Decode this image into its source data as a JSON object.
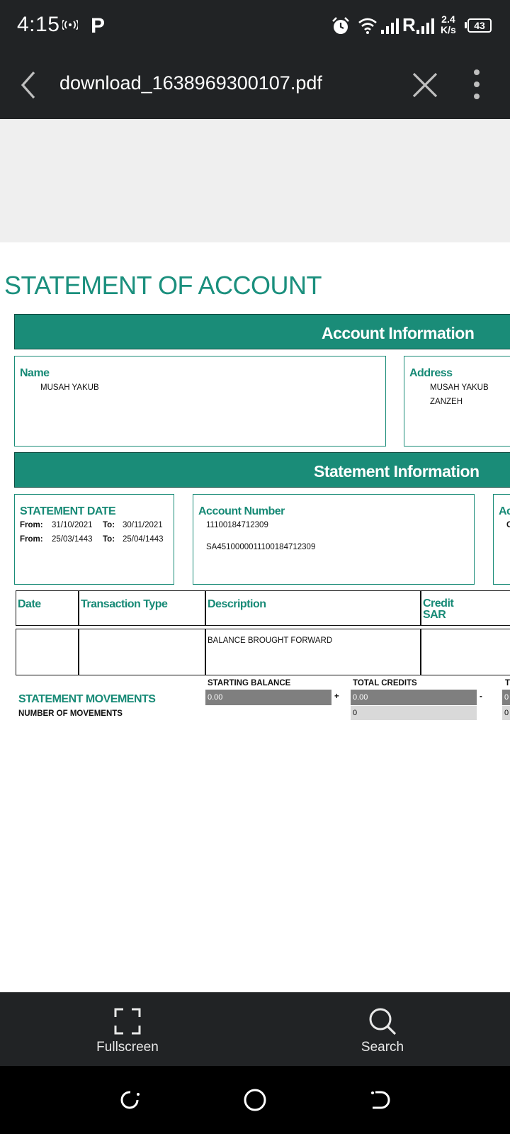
{
  "status": {
    "time": "4:15",
    "p_glyph": "P",
    "network_label": "R",
    "speed_value": "2.4",
    "speed_unit": "K/s",
    "battery": "43",
    "icons": [
      "hotspot-icon",
      "alarm-icon",
      "wifi-icon",
      "signal-icon",
      "battery-icon"
    ]
  },
  "toolbar": {
    "file_name": "download_1638969300107.pdf",
    "icons": [
      "back-icon",
      "close-icon",
      "more-icon"
    ]
  },
  "document": {
    "title": "STATEMENT OF ACCOUNT",
    "account_info": {
      "header": "Account Information",
      "name_label": "Name",
      "name_value": "MUSAH YAKUB",
      "address_label": "Address",
      "address_line1": "MUSAH YAKUB",
      "address_line2": "ZANZEH"
    },
    "statement_info": {
      "header": "Statement Information",
      "statement_date_label": "STATEMENT DATE",
      "from_label": "From:",
      "to_label": "To:",
      "gregorian_from": "31/10/2021",
      "gregorian_to": "30/11/2021",
      "hijri_from": "25/03/1443",
      "hijri_to": "25/04/1443",
      "account_number_label": "Account Number",
      "account_number": "11100184712309",
      "iban": "SA4510000011100184712309",
      "partial_label": "Ac",
      "partial_value": "C"
    },
    "table": {
      "headers": [
        "Date",
        "Transaction Type",
        "Description",
        "Credit",
        "SAR"
      ],
      "rows": [
        {
          "date": "",
          "type": "",
          "description": "BALANCE BROUGHT FORWARD",
          "credit": ""
        }
      ]
    },
    "summary": {
      "movements_label": "STATEMENT MOVEMENTS",
      "number_label": "NUMBER OF MOVEMENTS",
      "starting_balance_label": "STARTING BALANCE",
      "starting_balance": "0.00",
      "plus": "+",
      "total_credits_label": "TOTAL CREDITS",
      "total_credits": "0.00",
      "total_credits_count": "0",
      "minus": "-",
      "partial_label": "T",
      "partial_value": "0",
      "partial_count": "0"
    }
  },
  "bottom": {
    "fullscreen_label": "Fullscreen",
    "search_label": "Search"
  },
  "colors": {
    "teal": "#1a8c78",
    "dark_bar": "#212325",
    "gray_area": "#efefef"
  }
}
